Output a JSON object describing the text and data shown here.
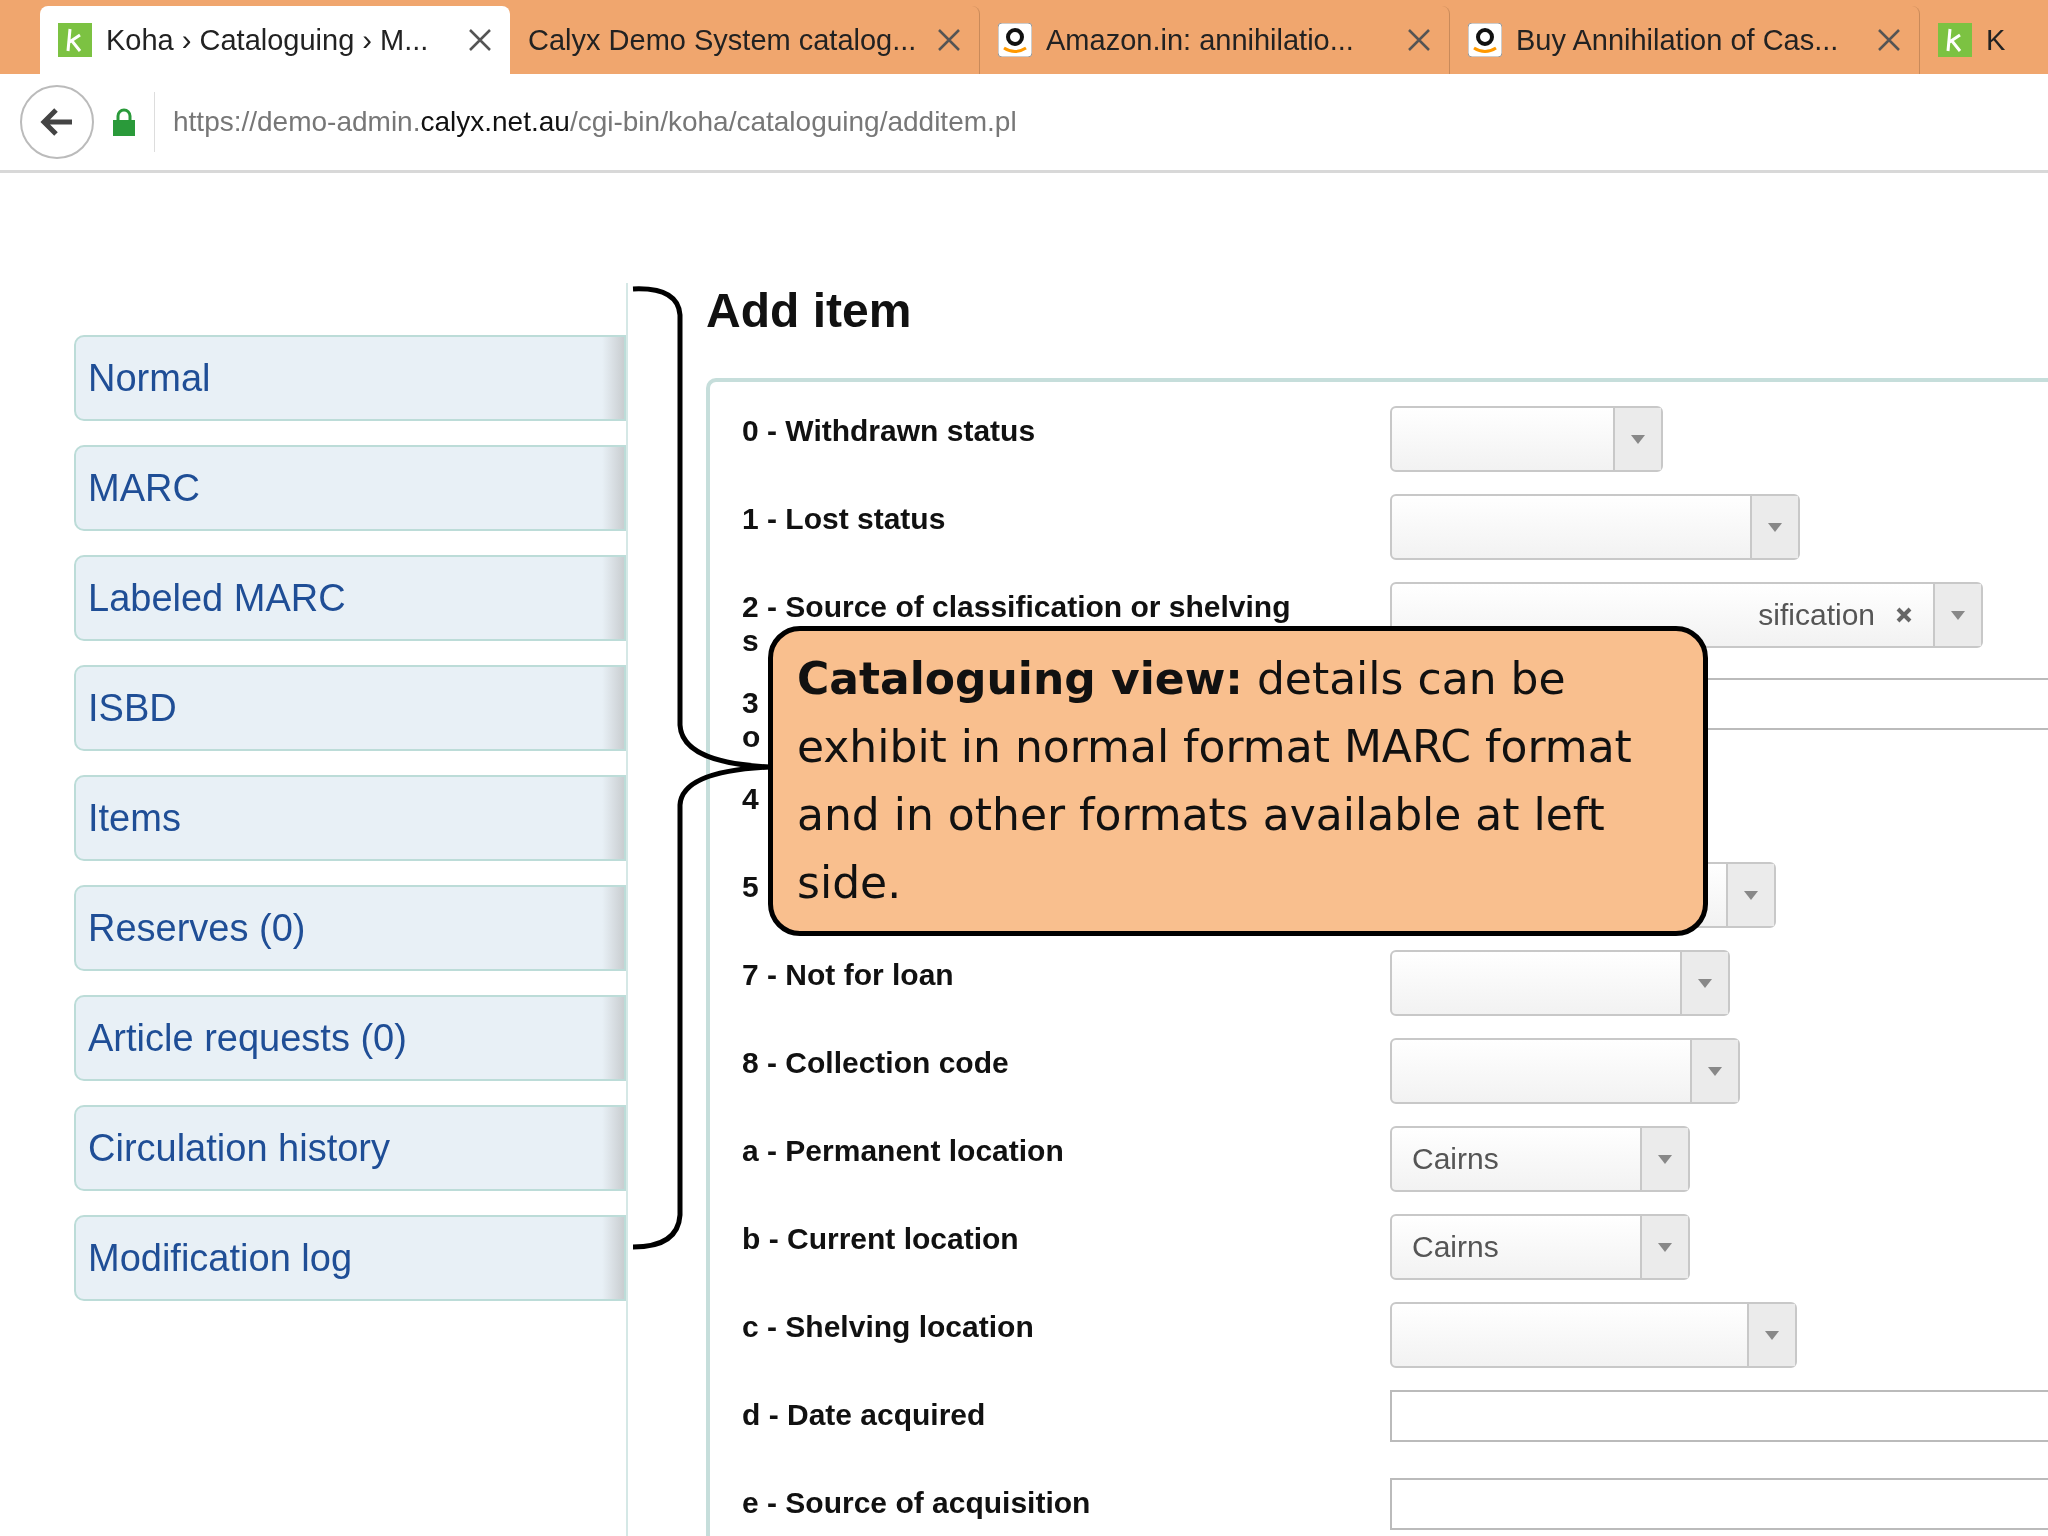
{
  "browser": {
    "tabs": [
      {
        "title": "Koha › Cataloguing › M...",
        "kind": "koha",
        "selected": true
      },
      {
        "title": "Calyx Demo System catalog...",
        "kind": "plain",
        "selected": false
      },
      {
        "title": "Amazon.in: annihilatio...",
        "kind": "amazon",
        "selected": false
      },
      {
        "title": "Buy Annihilation of Cas...",
        "kind": "amazon",
        "selected": false
      },
      {
        "title": "K",
        "kind": "koha",
        "selected": false
      }
    ],
    "url": {
      "start": "https://demo-admin.",
      "host": "calyx.net.au",
      "path": "/cgi-bin/koha/cataloguing/additem.pl"
    }
  },
  "sidebar": {
    "items": [
      "Normal",
      "MARC",
      "Labeled MARC",
      "ISBD",
      "Items",
      "Reserves (0)",
      "Article requests (0)",
      "Circulation history",
      "Modification log"
    ]
  },
  "heading": "Add item",
  "form": {
    "rows": [
      {
        "label": "0 - Withdrawn status",
        "field": {
          "kind": "select"
        }
      },
      {
        "label": "1 - Lost status",
        "field": {
          "kind": "select"
        }
      },
      {
        "label": "2 - Source of classification or shelving",
        "line2": "s",
        "field": {
          "kind": "select",
          "value": "sification",
          "clearable": true
        }
      },
      {
        "label": "3",
        "line2": "o",
        "field": {
          "kind": "text"
        }
      },
      {
        "label": "4",
        "field": {
          "kind": "none"
        }
      },
      {
        "label": "5",
        "field": {
          "kind": "select"
        }
      },
      {
        "label": "7 - Not for loan",
        "field": {
          "kind": "select"
        }
      },
      {
        "label": "8 - Collection code",
        "field": {
          "kind": "select"
        }
      },
      {
        "label": "a - Permanent location",
        "field": {
          "kind": "select",
          "value": "Cairns"
        }
      },
      {
        "label": "b - Current location",
        "field": {
          "kind": "select",
          "value": "Cairns"
        }
      },
      {
        "label": "c - Shelving location",
        "field": {
          "kind": "select"
        }
      },
      {
        "label": "d - Date acquired",
        "field": {
          "kind": "text"
        }
      },
      {
        "label": "e - Source of acquisition",
        "field": {
          "kind": "text"
        }
      }
    ]
  },
  "callout": {
    "text": "**Cataloguing view:** details can be exhibit in normal format MARC format and in other formats available at left side."
  }
}
